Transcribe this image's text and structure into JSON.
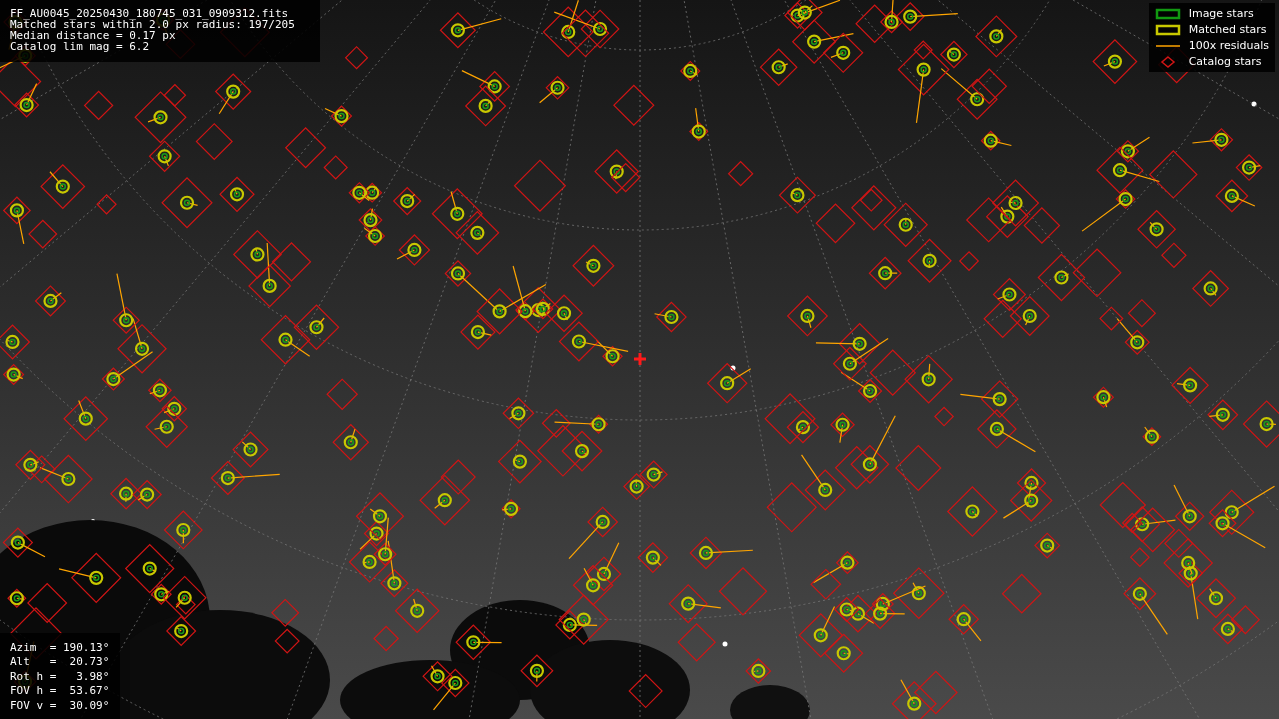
{
  "info": {
    "lines": [
      "FF_AU0045_20250430_180745_031_0909312.fits",
      "Matched stars within 2.0 px radius: 197/205",
      "Median distance = 0.17 px",
      "Catalog lim mag = 6.2"
    ]
  },
  "legend": {
    "items": [
      {
        "label": "Image stars"
      },
      {
        "kind": "matched",
        "label": "Matched stars"
      },
      {
        "kind": "residual",
        "label": "100x residuals"
      },
      {
        "kind": "catalog",
        "label": "Catalog stars"
      }
    ]
  },
  "pointing": {
    "lines": [
      "Azim  = 190.13°",
      "Alt   =  20.73°",
      "Rot h =   3.98°",
      "FOV h =  53.67°",
      "FOV v =  30.09°"
    ]
  }
}
